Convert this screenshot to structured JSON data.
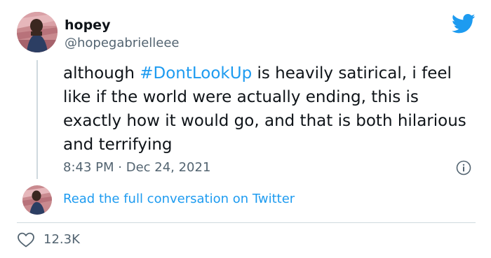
{
  "author": {
    "display_name": "hopey",
    "handle": "@hopegabrielleee"
  },
  "tweet": {
    "text_before": "although ",
    "hashtag": "#DontLookUp",
    "text_after": " is heavily satirical, i feel like if the world were actually ending, this is exactly how it would go, and that is both hilarious and terrifying",
    "time": "8:43 PM",
    "separator": " · ",
    "date": "Dec 24, 2021"
  },
  "conversation_link": "Read the full conversation on Twitter",
  "likes": {
    "count": "12.3K"
  },
  "icons": {
    "brand": "twitter-bird-icon",
    "info": "info-icon",
    "like": "heart-icon"
  },
  "colors": {
    "accent": "#1d9bf0",
    "secondary_text": "#536471",
    "primary_text": "#0f1419",
    "divider": "#cfd9de"
  }
}
